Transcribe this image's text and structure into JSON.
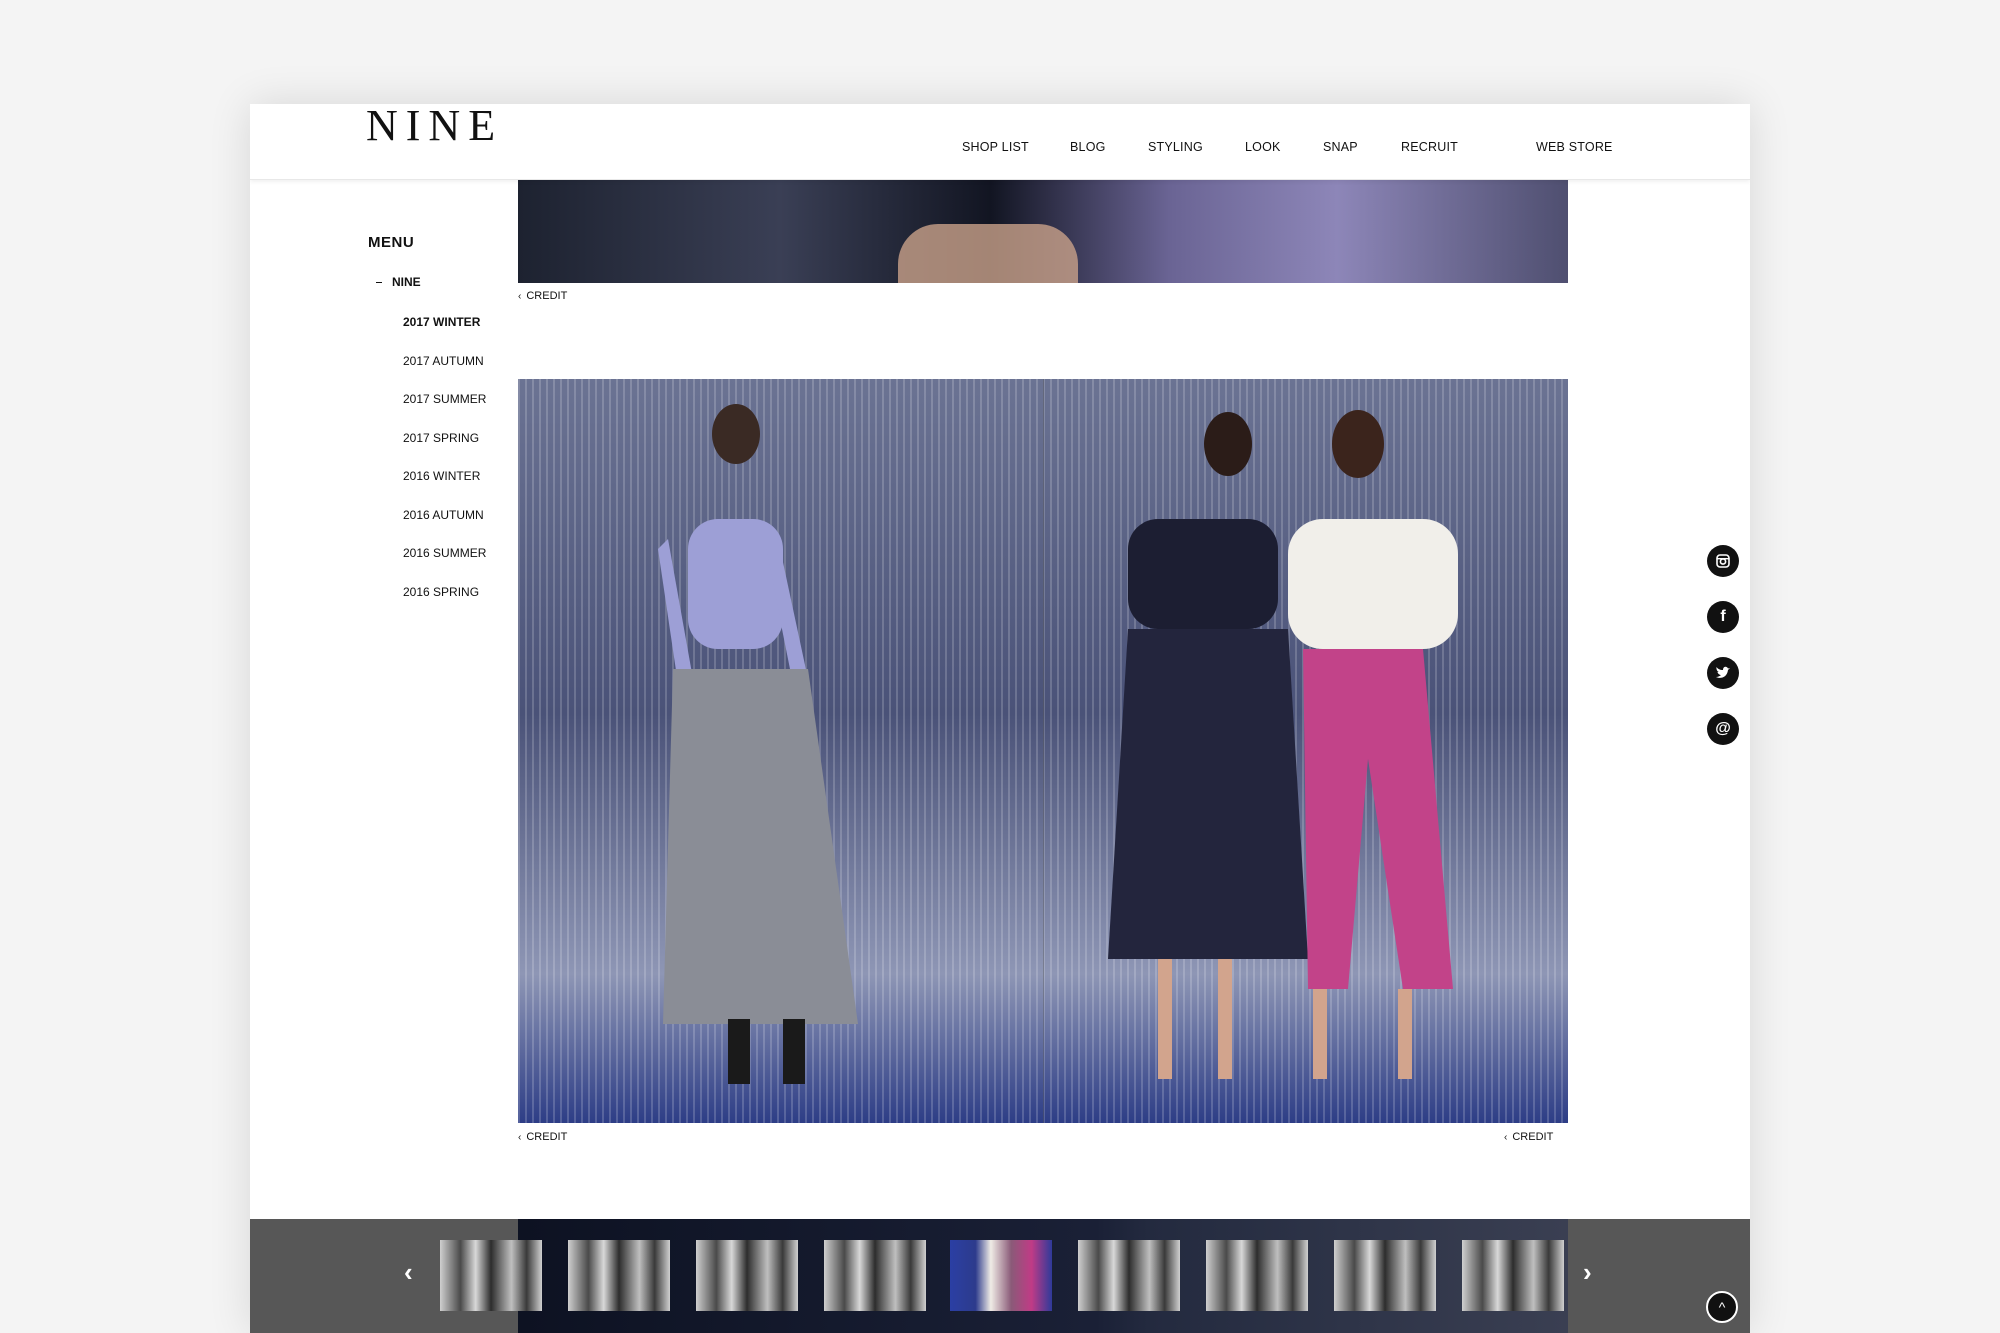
{
  "brand": {
    "logo": "NINE"
  },
  "nav": {
    "items": [
      "SHOP LIST",
      "BLOG",
      "STYLING",
      "LOOK",
      "SNAP",
      "RECRUIT",
      "WEB STORE"
    ]
  },
  "menu": {
    "title": "MENU",
    "parent": "NINE",
    "items": [
      "2017 WINTER",
      "2017 AUTUMN",
      "2017 SUMMER",
      "2017 SPRING",
      "2016 WINTER",
      "2016 AUTUMN",
      "2016 SUMMER",
      "2016 SPRING"
    ],
    "active": "2017 WINTER"
  },
  "credits": {
    "top": "CREDIT",
    "main_left": "CREDIT",
    "main_right": "CREDIT"
  },
  "social": [
    "instagram-icon",
    "facebook-icon",
    "twitter-icon",
    "mail-icon"
  ],
  "thumbnails": {
    "count": 9,
    "active_index": 4
  },
  "colors": {
    "accent": "#111111",
    "strip": "#575757",
    "page_bg": "#f4f4f4"
  }
}
